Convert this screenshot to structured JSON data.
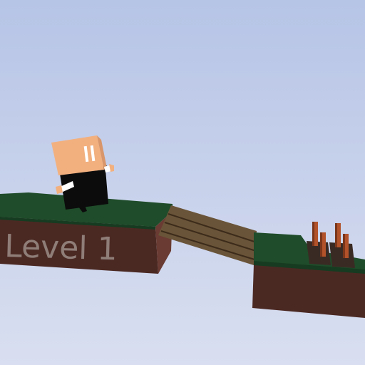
{
  "hud": {
    "level_label": "Level 1"
  },
  "colors": {
    "sky_top": "#b9c6e6",
    "sky_bottom": "#d8deef",
    "grass_top": "#1f4c2a",
    "grass_side": "#163b20",
    "dirt_front": "#4b2923",
    "dirt_side": "#6a3b32",
    "bridge_wood": "#6a5439",
    "bridge_slit": "#3c2b1a",
    "spike_wood": "#b1522a",
    "spike_dark": "#7a361b",
    "player_skin": "#f2b07f",
    "player_body": "#0c0c0c",
    "player_eyes": "#ffffff",
    "label_text": "#8f7d78"
  }
}
